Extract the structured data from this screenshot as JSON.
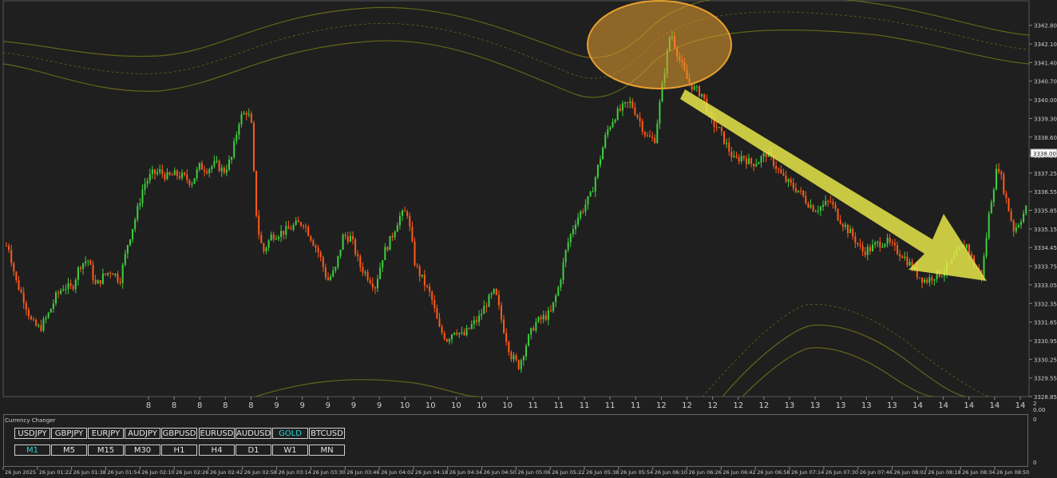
{
  "colors": {
    "background": "#1f1f1f",
    "bull": "#3fcf3f",
    "bear": "#ff5a1a",
    "envelope": "#6b6b1a",
    "ellipse": "#e8a030",
    "arrow": "#e6e64a",
    "active_button": "#27d6d6",
    "grid_text": "#cfcfcf"
  },
  "chart_data": {
    "type": "candlestick",
    "symbol": "GOLD",
    "timeframe": "M1",
    "ylim": [
      3328.85,
      3343.3
    ],
    "y_ticks": [
      "3342.80",
      "3342.10",
      "3341.40",
      "3340.70",
      "3340.00",
      "3339.30",
      "3338.60",
      "3337.90",
      "3337.25",
      "3336.55",
      "3335.85",
      "3335.15",
      "3334.45",
      "3333.75",
      "3333.05",
      "3332.35",
      "3331.65",
      "3330.95",
      "3330.25",
      "3329.55",
      "3328.85"
    ],
    "current_price": "3338.00",
    "hour_labels": [
      "8",
      "8",
      "8",
      "8",
      "8",
      "9",
      "9",
      "9",
      "9",
      "9",
      "10",
      "10",
      "10",
      "10",
      "10",
      "11",
      "11",
      "11",
      "11",
      "11",
      "12",
      "12",
      "12",
      "12",
      "12",
      "13",
      "13",
      "13",
      "13",
      "13",
      "14",
      "14",
      "14",
      "14",
      "14"
    ],
    "hour_right_label": "2",
    "hour_right_sub": "0.00",
    "time_labels": [
      "26 Jun 2025",
      "26 Jun 01:22",
      "26 Jun 01:38",
      "26 Jun 01:54",
      "26 Jun 02:10",
      "26 Jun 02:26",
      "26 Jun 02:42",
      "26 Jun 02:58",
      "26 Jun 03:14",
      "26 Jun 03:30",
      "26 Jun 03:46",
      "26 Jun 04:02",
      "26 Jun 04:18",
      "26 Jun 04:34",
      "26 Jun 04:50",
      "26 Jun 05:06",
      "26 Jun 05:22",
      "26 Jun 05:38",
      "26 Jun 05:54",
      "26 Jun 06:10",
      "26 Jun 06:26",
      "26 Jun 06:42",
      "26 Jun 06:58",
      "26 Jun 07:14",
      "26 Jun 07:30",
      "26 Jun 07:46",
      "26 Jun 08:02",
      "26 Jun 08:18",
      "26 Jun 08:34",
      "26 Jun 08:50"
    ],
    "price_path": [
      [
        0,
        3334.2
      ],
      [
        10,
        3334.6
      ],
      [
        20,
        3333.2
      ],
      [
        30,
        3332.5
      ],
      [
        40,
        3331.6
      ],
      [
        50,
        3331.4
      ],
      [
        60,
        3331.9
      ],
      [
        70,
        3332.6
      ],
      [
        80,
        3333.0
      ],
      [
        90,
        3332.9
      ],
      [
        100,
        3333.8
      ],
      [
        110,
        3334.0
      ],
      [
        120,
        3333.0
      ],
      [
        130,
        3333.4
      ],
      [
        140,
        3333.6
      ],
      [
        150,
        3333.2
      ],
      [
        160,
        3334.6
      ],
      [
        170,
        3335.6
      ],
      [
        180,
        3336.8
      ],
      [
        190,
        3337.2
      ],
      [
        200,
        3337.3
      ],
      [
        210,
        3337.1
      ],
      [
        220,
        3337.2
      ],
      [
        230,
        3337.1
      ],
      [
        240,
        3336.9
      ],
      [
        250,
        3337.5
      ],
      [
        260,
        3337.4
      ],
      [
        270,
        3337.6
      ],
      [
        280,
        3337.3
      ],
      [
        290,
        3337.8
      ],
      [
        300,
        3339.3
      ],
      [
        310,
        3339.6
      ],
      [
        315,
        3339.0
      ],
      [
        320,
        3336.0
      ],
      [
        325,
        3334.8
      ],
      [
        330,
        3334.3
      ],
      [
        340,
        3334.9
      ],
      [
        350,
        3335.0
      ],
      [
        360,
        3335.1
      ],
      [
        370,
        3335.3
      ],
      [
        380,
        3335.4
      ],
      [
        390,
        3334.8
      ],
      [
        400,
        3334.2
      ],
      [
        410,
        3333.2
      ],
      [
        420,
        3333.6
      ],
      [
        430,
        3334.9
      ],
      [
        440,
        3334.8
      ],
      [
        450,
        3333.8
      ],
      [
        460,
        3333.4
      ],
      [
        470,
        3333.0
      ],
      [
        480,
        3334.2
      ],
      [
        490,
        3334.8
      ],
      [
        500,
        3335.6
      ],
      [
        510,
        3335.8
      ],
      [
        520,
        3333.8
      ],
      [
        530,
        3333.2
      ],
      [
        540,
        3332.6
      ],
      [
        550,
        3331.4
      ],
      [
        560,
        3331.0
      ],
      [
        570,
        3331.4
      ],
      [
        580,
        3331.1
      ],
      [
        590,
        3331.5
      ],
      [
        600,
        3331.8
      ],
      [
        610,
        3332.4
      ],
      [
        620,
        3332.8
      ],
      [
        630,
        3331.5
      ],
      [
        640,
        3330.4
      ],
      [
        650,
        3330.0
      ],
      [
        660,
        3330.9
      ],
      [
        670,
        3331.6
      ],
      [
        680,
        3331.8
      ],
      [
        690,
        3332.0
      ],
      [
        700,
        3333.0
      ],
      [
        710,
        3334.5
      ],
      [
        720,
        3335.4
      ],
      [
        730,
        3335.9
      ],
      [
        740,
        3336.4
      ],
      [
        750,
        3337.6
      ],
      [
        760,
        3338.8
      ],
      [
        770,
        3339.4
      ],
      [
        780,
        3339.7
      ],
      [
        790,
        3339.9
      ],
      [
        800,
        3339.3
      ],
      [
        810,
        3338.6
      ],
      [
        820,
        3338.5
      ],
      [
        830,
        3340.6
      ],
      [
        840,
        3342.6
      ],
      [
        850,
        3341.6
      ],
      [
        860,
        3340.8
      ],
      [
        870,
        3340.4
      ],
      [
        880,
        3340.2
      ],
      [
        890,
        3339.2
      ],
      [
        900,
        3338.9
      ],
      [
        910,
        3338.3
      ],
      [
        920,
        3337.7
      ],
      [
        930,
        3337.9
      ],
      [
        940,
        3337.6
      ],
      [
        950,
        3337.7
      ],
      [
        960,
        3338.0
      ],
      [
        970,
        3337.6
      ],
      [
        980,
        3337.1
      ],
      [
        990,
        3336.8
      ],
      [
        1000,
        3336.6
      ],
      [
        1010,
        3336.2
      ],
      [
        1020,
        3335.9
      ],
      [
        1030,
        3336.0
      ],
      [
        1040,
        3336.2
      ],
      [
        1050,
        3335.6
      ],
      [
        1060,
        3335.2
      ],
      [
        1070,
        3334.8
      ],
      [
        1080,
        3334.3
      ],
      [
        1090,
        3334.4
      ],
      [
        1100,
        3334.6
      ],
      [
        1110,
        3334.7
      ],
      [
        1120,
        3334.4
      ],
      [
        1130,
        3334.2
      ],
      [
        1140,
        3333.8
      ],
      [
        1150,
        3333.4
      ],
      [
        1160,
        3333.2
      ],
      [
        1170,
        3333.4
      ],
      [
        1180,
        3333.5
      ],
      [
        1190,
        3333.8
      ],
      [
        1200,
        3334.3
      ],
      [
        1210,
        3334.6
      ],
      [
        1220,
        3333.8
      ],
      [
        1230,
        3333.4
      ],
      [
        1240,
        3336.0
      ],
      [
        1250,
        3337.6
      ],
      [
        1260,
        3336.3
      ],
      [
        1270,
        3335.1
      ],
      [
        1280,
        3335.6
      ],
      [
        1290,
        3336.2
      ]
    ]
  },
  "panel": {
    "title": "Currency Changer",
    "scale_top": "0",
    "scale_bottom": "0",
    "symbol_buttons": [
      "USDJPY",
      "GBPJPY",
      "EURJPY",
      "AUDJPY",
      "GBPUSD",
      "EURUSD",
      "AUDUSD",
      "GOLD",
      "BTCUSD"
    ],
    "timeframe_buttons": [
      "M1",
      "M5",
      "M15",
      "M30",
      "H1",
      "H4",
      "D1",
      "W1",
      "MN"
    ],
    "active_symbol": "GOLD",
    "active_timeframe": "M1"
  }
}
